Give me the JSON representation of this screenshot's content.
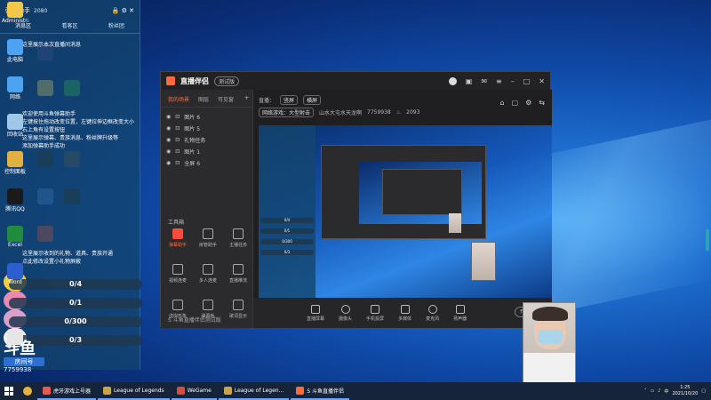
{
  "desktop": {
    "icons": [
      {
        "label": "Administrator",
        "color": "#f2c84b"
      },
      {
        "label": "此电脑",
        "color": "#4ba3f2"
      },
      {
        "label": "网络",
        "color": "#4ba3f2"
      },
      {
        "label": "回收站",
        "color": "#9fc7e8"
      },
      {
        "label": "控制面板",
        "color": "#e0b040"
      },
      {
        "label": "腾讯QQ",
        "color": "#1a1a1a"
      },
      {
        "label": "Excel",
        "color": "#1e8e3e"
      },
      {
        "label": "Word",
        "color": "#2b5fd0"
      },
      {
        "label": "",
        "color": "#e6e6e6"
      }
    ],
    "mid_icons": [
      {
        "label": "",
        "color": "#3b3b8f"
      },
      {
        "label": "",
        "color": "#f0d060"
      },
      {
        "label": "",
        "color": "#2a2a2a"
      },
      {
        "label": "",
        "color": "#3e7bd6"
      },
      {
        "label": "",
        "color": "#e24b3a"
      },
      {
        "label": "",
        "color": "#2bb34a"
      },
      {
        "label": "",
        "color": "#555"
      },
      {
        "label": "",
        "color": "#2a2a2a"
      }
    ]
  },
  "danmu": {
    "title": "弹幕助手",
    "id_small": "2080",
    "tabs": [
      "消息区",
      "看客区",
      "粉丝团"
    ],
    "messages": [
      "这里展示本次直播间消息",
      "欢迎使用斗鱼弹幕助手",
      "左键按住拖动改变位置，左键拉伸边框改变大小",
      "右上角有设置按钮",
      "这里展示弹幕、贵族消息、粉丝牌升级等",
      "添加弹幕助手成功",
      "这里展示收到的礼物、道具、贵族开通",
      "点此修改设置小礼物屏蔽"
    ],
    "gifts": [
      "0/4",
      "0/1",
      "0/300",
      "0/3"
    ],
    "logo_big": "斗鱼",
    "logo_sub": "房间号",
    "room_no": "7759938"
  },
  "app": {
    "brand": "直播伴侣",
    "version": "测试版",
    "side_tabs": [
      "我的场景",
      "图层",
      "可见窗"
    ],
    "scenes": [
      "图片 6",
      "图片 5",
      "礼物任务",
      "图片 1",
      "全屏 6"
    ],
    "tools_title": "工具箱",
    "tools": [
      {
        "label": "弹幕助手",
        "hot": true
      },
      {
        "label": "房管助手",
        "hot": false
      },
      {
        "label": "主播任务",
        "hot": false
      },
      {
        "label": "视频连麦",
        "hot": false
      },
      {
        "label": "多人连麦",
        "hot": false
      },
      {
        "label": "直播推流",
        "hot": false
      },
      {
        "label": "虚拟形象",
        "hot": false
      },
      {
        "label": "弹幕板",
        "hot": false
      },
      {
        "label": "歌词显示",
        "hot": false
      }
    ],
    "stage_top": {
      "mode_label": "直播：",
      "mode_a": "竖屏",
      "mode_b": "横屏",
      "category": "网络游戏：大型射击",
      "room_label": "山水大屯水天龙啊",
      "room_id": "7759938",
      "viewer_icon": "flame-icon",
      "viewers": "2093"
    },
    "bottom_buttons": [
      "直播屏幕",
      "摄像头",
      "手机投屏",
      "多媒体",
      "麦克风",
      "扬声器"
    ],
    "start_label": "开始直播",
    "status_text": "S 斗鱼直播伴侣测试版"
  },
  "taskbar": {
    "items": [
      {
        "label": "虎牙游戏上号器",
        "color": "#e85a4f"
      },
      {
        "label": "League of Legends",
        "color": "#c8a44a"
      },
      {
        "label": "WeGame",
        "color": "#d94b3a"
      },
      {
        "label": "League of Legen...",
        "color": "#c8a44a"
      },
      {
        "label": "S 斗鱼直播伴侣",
        "color": "#ff6a3d"
      }
    ],
    "time": "1:25",
    "date": "2021/10/20",
    "ime": "中"
  },
  "colors": {
    "accent": "#ff6a3d",
    "panel": "#2b2b2e"
  }
}
